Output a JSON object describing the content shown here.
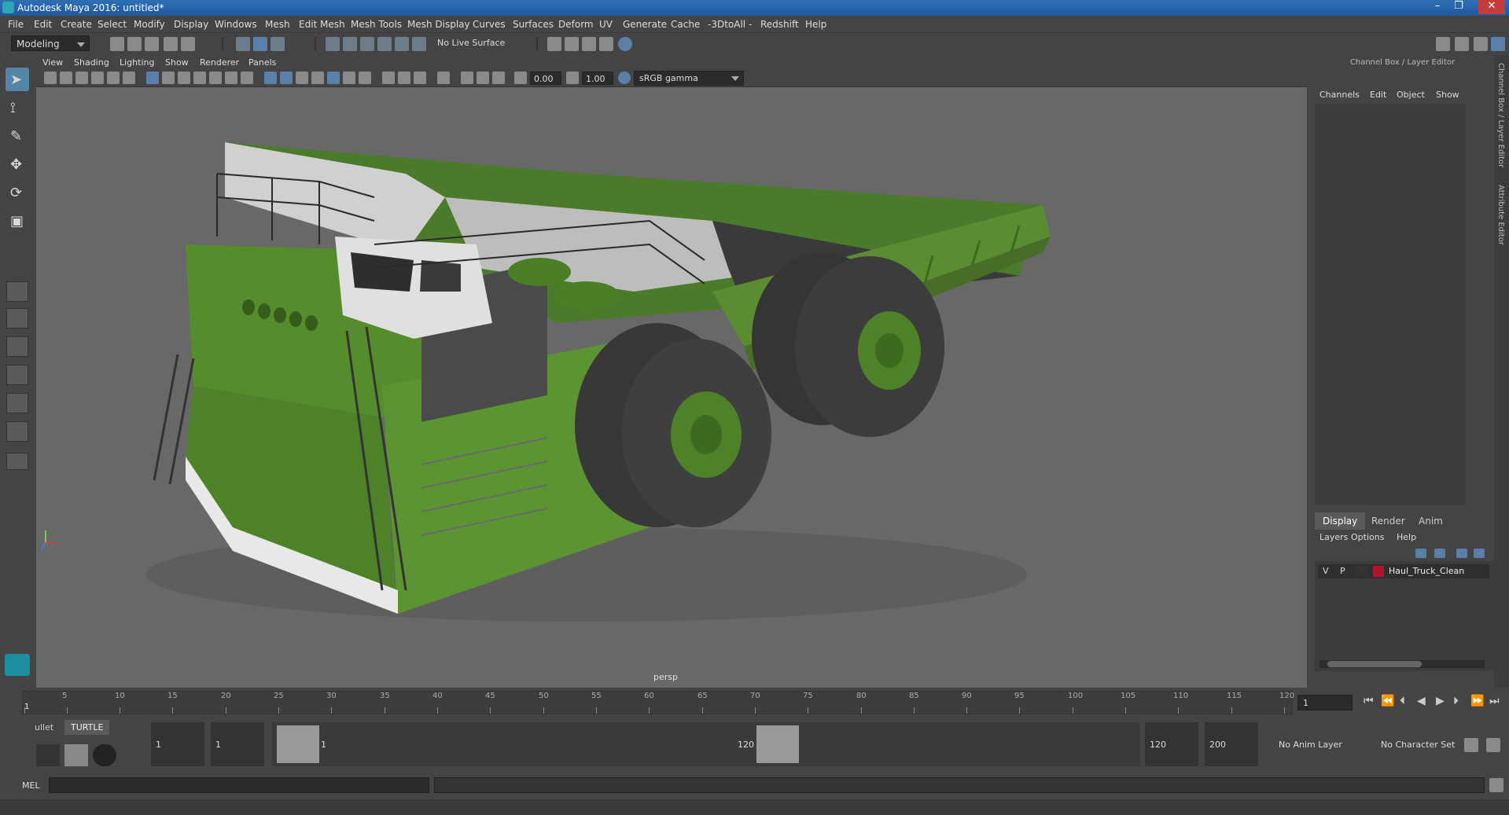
{
  "window": {
    "title": "Autodesk Maya 2016: untitled*",
    "minimize": "–",
    "maximize": "❐",
    "close": "✕"
  },
  "menus": [
    "File",
    "Edit",
    "Create",
    "Select",
    "Modify",
    "Display",
    "Windows",
    "Mesh",
    "Edit Mesh",
    "Mesh Tools",
    "Mesh Display",
    "Curves",
    "Surfaces",
    "Deform",
    "UV",
    "Generate",
    "Cache",
    "-3DtoAll -",
    "Redshift",
    "Help"
  ],
  "statusline": {
    "mode": "Modeling",
    "live_surface": "No Live Surface"
  },
  "viewport": {
    "menus": [
      "View",
      "Shading",
      "Lighting",
      "Show",
      "Renderer",
      "Panels"
    ],
    "exposure": "0.00",
    "gamma": "1.00",
    "color_space": "sRGB gamma",
    "camera_label": "persp",
    "model_name": "Haul_Truck_Clean"
  },
  "channel_box": {
    "title": "Channel Box / Layer Editor",
    "menus": [
      "Channels",
      "Edit",
      "Object",
      "Show"
    ],
    "layer_tabs": [
      "Display",
      "Render",
      "Anim"
    ],
    "layer_menus": [
      "Layers",
      "Options",
      "Help"
    ],
    "layer": {
      "visible": "V",
      "playback": "P",
      "name": "Haul_Truck_Clean",
      "color": "#b3122a"
    },
    "side_tabs": [
      "Channel Box / Layer Editor",
      "Attribute Editor"
    ]
  },
  "timeline": {
    "ticks": [
      "1",
      "5",
      "10",
      "15",
      "20",
      "25",
      "30",
      "35",
      "40",
      "45",
      "50",
      "55",
      "60",
      "65",
      "70",
      "75",
      "80",
      "85",
      "90",
      "95",
      "100",
      "105",
      "110",
      "115",
      "120"
    ],
    "current_frame": "1"
  },
  "range": {
    "shelf_tabs": [
      "ullet",
      "TURTLE"
    ],
    "start_field": "1",
    "start_field2": "1",
    "range_start": "1",
    "range_end": "120",
    "end_field": "120",
    "end_field2": "200",
    "anim_layer": "No Anim Layer",
    "character_set": "No Character Set"
  },
  "commandline": {
    "label": "MEL"
  }
}
